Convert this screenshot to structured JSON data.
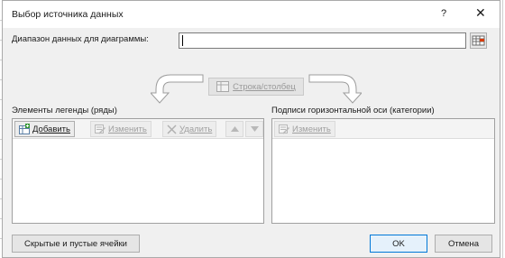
{
  "dialog": {
    "title": "Выбор источника данных",
    "help_label": "?",
    "close_label": "✕"
  },
  "range": {
    "label": "Диапазон данных для диаграммы:",
    "value": ""
  },
  "switch": {
    "label": "Строка/столбец"
  },
  "legend": {
    "label": "Элементы легенды (ряды)",
    "add_label": "Добавить",
    "edit_label": "Изменить",
    "delete_label": "Удалить",
    "up_icon": "up-arrow",
    "down_icon": "down-arrow",
    "items": []
  },
  "axis": {
    "label": "Подписи горизонтальной оси (категории)",
    "edit_label": "Изменить",
    "items": []
  },
  "footer": {
    "hidden_cells_label": "Скрытые и пустые ячейки",
    "ok_label": "OK",
    "cancel_label": "Отмена"
  },
  "colors": {
    "accent": "#0078d7",
    "disabled_text": "#a0a0a0",
    "dialog_bg": "#f0f0f0"
  }
}
